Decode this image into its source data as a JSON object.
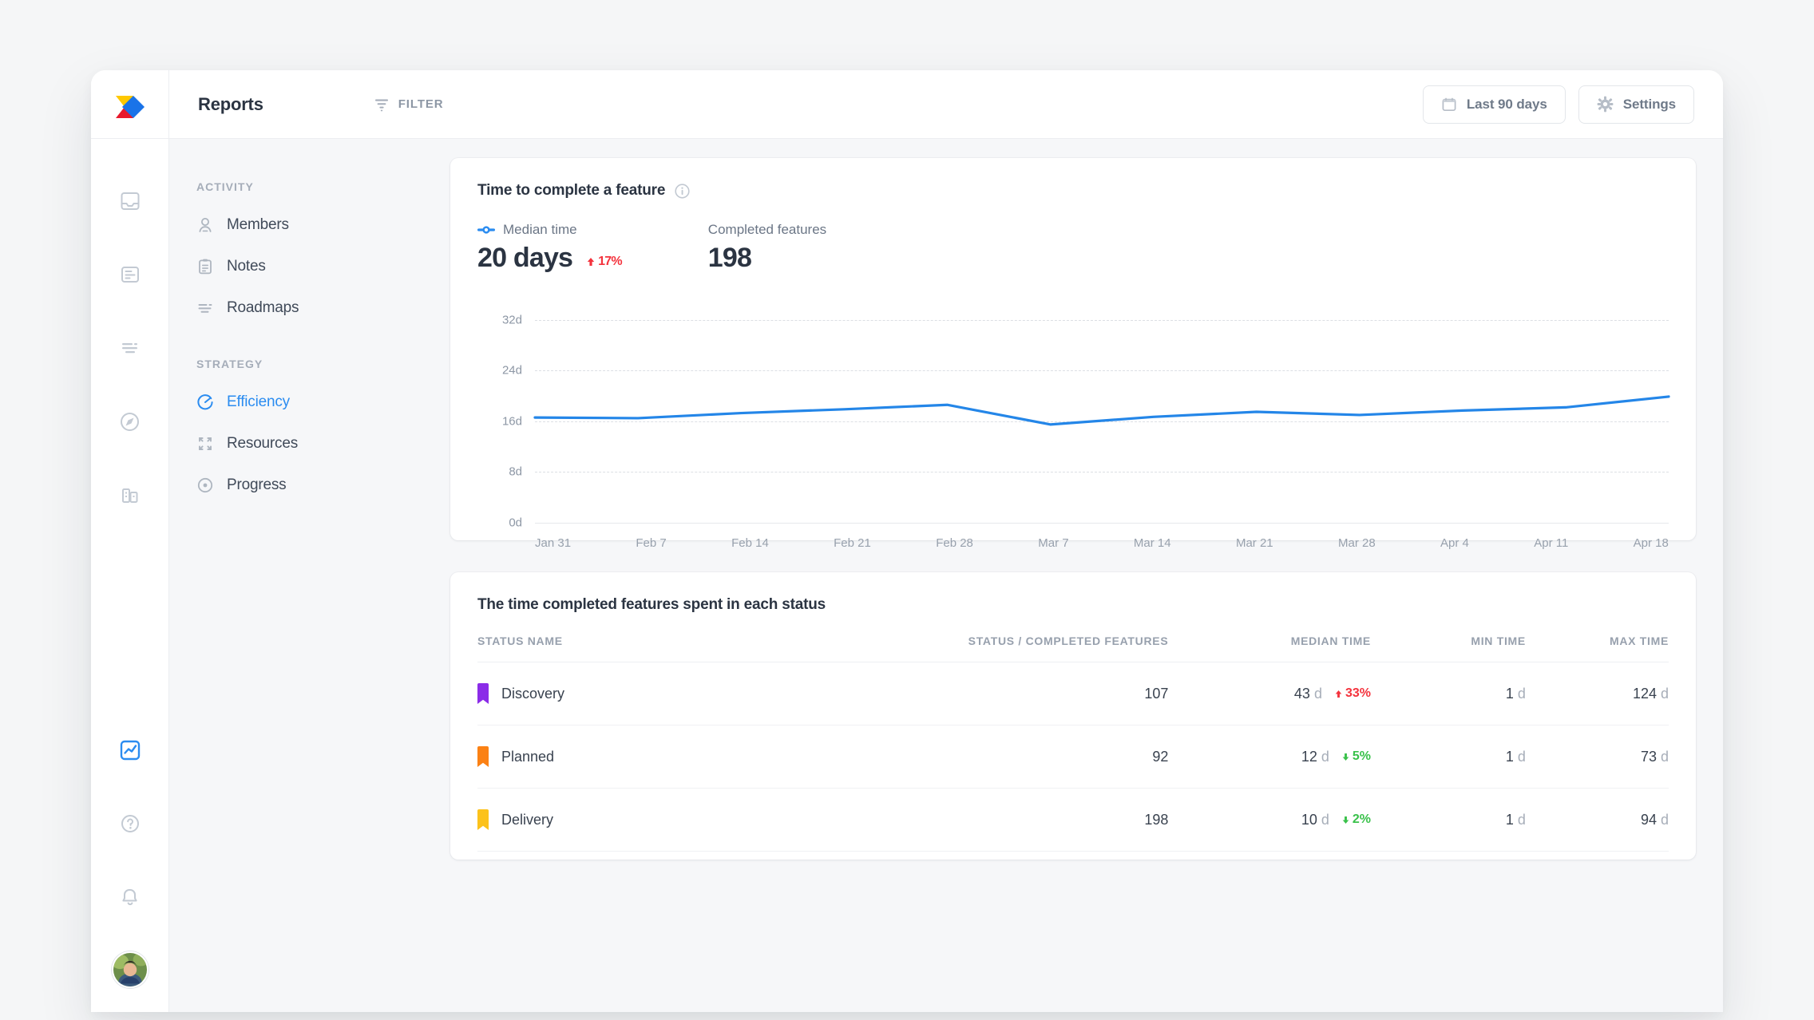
{
  "colors": {
    "accent": "#2b8cf0",
    "line": "#2486e8",
    "up": "#f4333d",
    "down": "#39c14a",
    "logo_yellow": "#ffc800",
    "logo_blue": "#1a73e8",
    "logo_red": "#e8192c"
  },
  "topbar": {
    "logo_icon": "arrow-logo-icon",
    "title": "Reports",
    "filter_label": "FILTER",
    "filter_icon": "filter-icon",
    "date_range_label": "Last 90 days",
    "calendar_icon": "calendar-icon",
    "settings_label": "Settings",
    "gear_icon": "gear-icon"
  },
  "icon_rail": {
    "items": [
      {
        "icon": "inbox-icon",
        "active": false
      },
      {
        "icon": "document-icon",
        "active": false
      },
      {
        "icon": "roadmap-lines-icon",
        "active": false
      },
      {
        "icon": "compass-icon",
        "active": false
      },
      {
        "icon": "building-icon",
        "active": false
      }
    ],
    "bottom": [
      {
        "icon": "reports-chart-icon",
        "active": true
      },
      {
        "icon": "help-circle-icon",
        "active": false
      },
      {
        "icon": "bell-icon",
        "active": false
      }
    ],
    "avatar": "user-avatar"
  },
  "section_nav": {
    "groups": [
      {
        "label": "ACTIVITY",
        "items": [
          {
            "label": "Members",
            "icon": "person-icon",
            "active": false
          },
          {
            "label": "Notes",
            "icon": "notes-icon",
            "active": false
          },
          {
            "label": "Roadmaps",
            "icon": "roadmap-lines-icon",
            "active": false
          }
        ]
      },
      {
        "label": "STRATEGY",
        "items": [
          {
            "label": "Efficiency",
            "icon": "efficiency-gauge-icon",
            "active": true
          },
          {
            "label": "Resources",
            "icon": "resources-expand-icon",
            "active": false
          },
          {
            "label": "Progress",
            "icon": "progress-target-icon",
            "active": false
          }
        ]
      }
    ]
  },
  "chart_card": {
    "title": "Time to complete a feature",
    "info_icon": "info-icon",
    "metrics": [
      {
        "label": "Median time",
        "marker": "median-line-marker",
        "value": "20 days",
        "delta": "17%",
        "delta_dir": "up"
      },
      {
        "label": "Completed features",
        "marker": null,
        "value": "198",
        "delta": null,
        "delta_dir": null
      }
    ]
  },
  "chart_data": {
    "type": "line",
    "title": "Time to complete a feature",
    "xlabel": "",
    "ylabel": "days",
    "ylim": [
      0,
      36
    ],
    "yticks": [
      0,
      8,
      16,
      24,
      32
    ],
    "ytick_labels": [
      "0d",
      "8d",
      "16d",
      "24d",
      "32d"
    ],
    "grid": true,
    "legend": "Median time",
    "x": [
      "Jan 31",
      "Feb 7",
      "Feb 14",
      "Feb 21",
      "Feb 28",
      "Mar 7",
      "Mar 14",
      "Mar 21",
      "Mar 28",
      "Apr 4",
      "Apr 11",
      "Apr 18"
    ],
    "series": [
      {
        "name": "Median time",
        "color": "#2486e8",
        "values": [
          16.6,
          16.5,
          17.3,
          17.9,
          18.6,
          15.5,
          16.7,
          17.5,
          17.0,
          17.7,
          18.2,
          19.9
        ]
      }
    ]
  },
  "table_card": {
    "title": "The time completed features spent in each status",
    "columns": [
      "STATUS NAME",
      "STATUS / COMPLETED FEATURES",
      "MEDIAN TIME",
      "MIN TIME",
      "MAX TIME"
    ],
    "rows": [
      {
        "tag_color": "#8b2ce8",
        "status": "Discovery",
        "completed": "107",
        "median": "43",
        "median_unit": "d",
        "delta": "33%",
        "delta_dir": "up",
        "min": "1",
        "min_unit": "d",
        "max": "124",
        "max_unit": "d"
      },
      {
        "tag_color": "#fb8114",
        "status": "Planned",
        "completed": "92",
        "median": "12",
        "median_unit": "d",
        "delta": "5%",
        "delta_dir": "down",
        "min": "1",
        "min_unit": "d",
        "max": "73",
        "max_unit": "d"
      },
      {
        "tag_color": "#fcc21b",
        "status": "Delivery",
        "completed": "198",
        "median": "10",
        "median_unit": "d",
        "delta": "2%",
        "delta_dir": "down",
        "min": "1",
        "min_unit": "d",
        "max": "94",
        "max_unit": "d"
      }
    ]
  }
}
